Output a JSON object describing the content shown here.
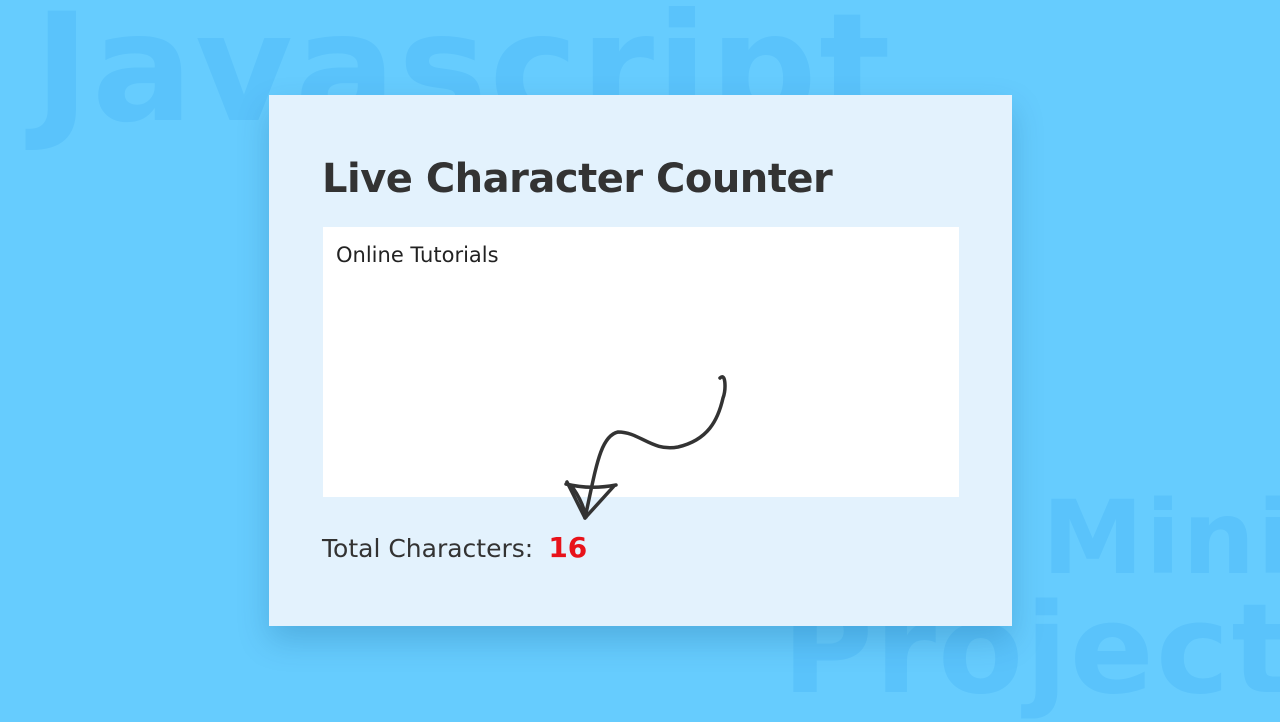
{
  "background": {
    "color": "#66ccfe",
    "watermark_words": [
      "Javascript",
      "Mini",
      "Project"
    ]
  },
  "card": {
    "title": "Live Character Counter",
    "textarea_value": "Online Tutorials",
    "counter_label": "Total Characters:",
    "counter_value": "16",
    "counter_color": "#e8121a"
  },
  "annotation": {
    "icon": "hand-drawn-arrow-icon"
  }
}
